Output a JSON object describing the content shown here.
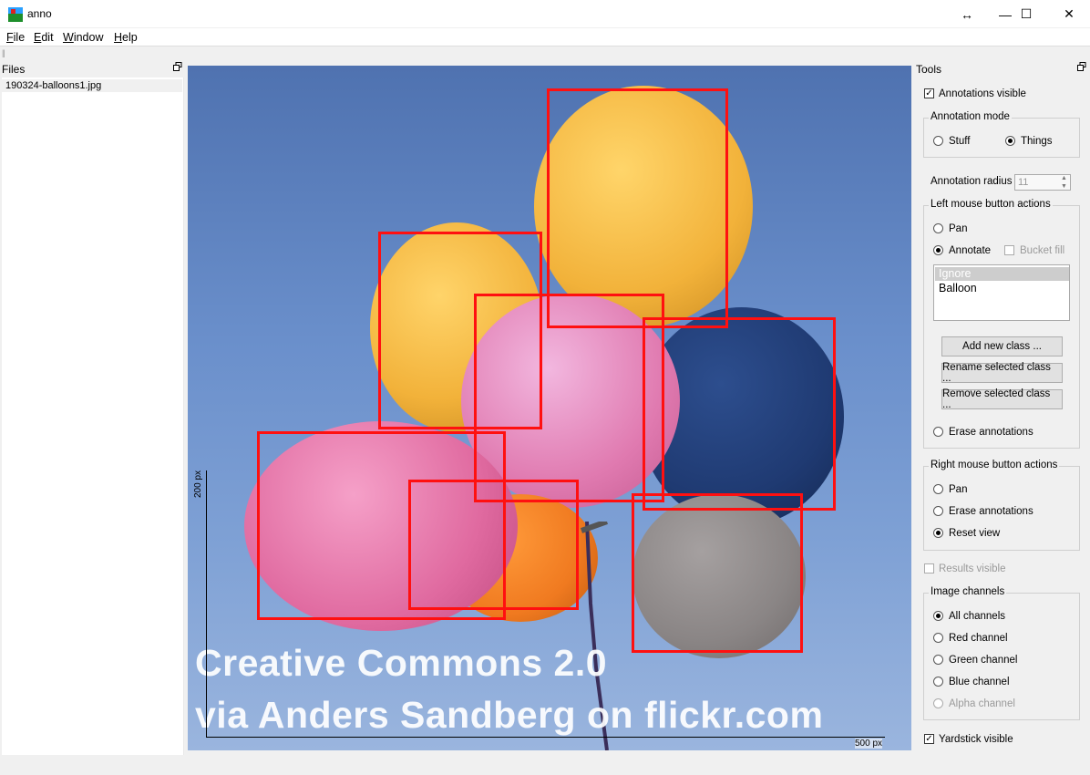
{
  "window": {
    "title": "anno",
    "resize_glyph": "↔",
    "minimize_glyph": "—",
    "maximize_glyph": "☐",
    "close_glyph": "✕"
  },
  "menu": {
    "items": [
      {
        "mnemonic": "F",
        "rest": "ile"
      },
      {
        "mnemonic": "E",
        "rest": "dit"
      },
      {
        "mnemonic": "W",
        "rest": "indow"
      },
      {
        "mnemonic": "H",
        "rest": "elp"
      }
    ]
  },
  "files_panel": {
    "title": "Files",
    "files": [
      "190324-balloons1.jpg"
    ]
  },
  "image": {
    "watermark_line1": "Creative Commons 2.0",
    "watermark_line2": "via Anders Sandberg on flickr.com",
    "yardstick_v_label": "200 px",
    "yardstick_h_label": "500 px",
    "box_color": "#ff1010"
  },
  "tools_panel": {
    "title": "Tools",
    "annotations_visible_label": "Annotations visible",
    "annotations_visible": true,
    "annotation_mode": {
      "title": "Annotation mode",
      "stuff_label": "Stuff",
      "things_label": "Things",
      "selected": "Things"
    },
    "annotation_radius": {
      "label": "Annotation radius",
      "value": "11"
    },
    "left_mouse": {
      "title": "Left mouse button actions",
      "pan_label": "Pan",
      "annotate_label": "Annotate",
      "bucket_fill_label": "Bucket fill",
      "selected": "Annotate",
      "classes": [
        "Ignore",
        "Balloon"
      ],
      "add_class_label": "Add new class ...",
      "rename_class_label": "Rename selected class ...",
      "remove_class_label": "Remove selected class ...",
      "erase_label": "Erase annotations"
    },
    "right_mouse": {
      "title": "Right mouse button actions",
      "pan_label": "Pan",
      "erase_label": "Erase annotations",
      "reset_label": "Reset view",
      "selected": "Reset view"
    },
    "results_visible_label": "Results visible",
    "image_channels": {
      "title": "Image channels",
      "all_label": "All channels",
      "red_label": "Red channel",
      "green_label": "Green channel",
      "blue_label": "Blue channel",
      "alpha_label": "Alpha channel",
      "selected": "All channels"
    },
    "yardstick_visible_label": "Yardstick visible",
    "yardstick_visible": true
  }
}
